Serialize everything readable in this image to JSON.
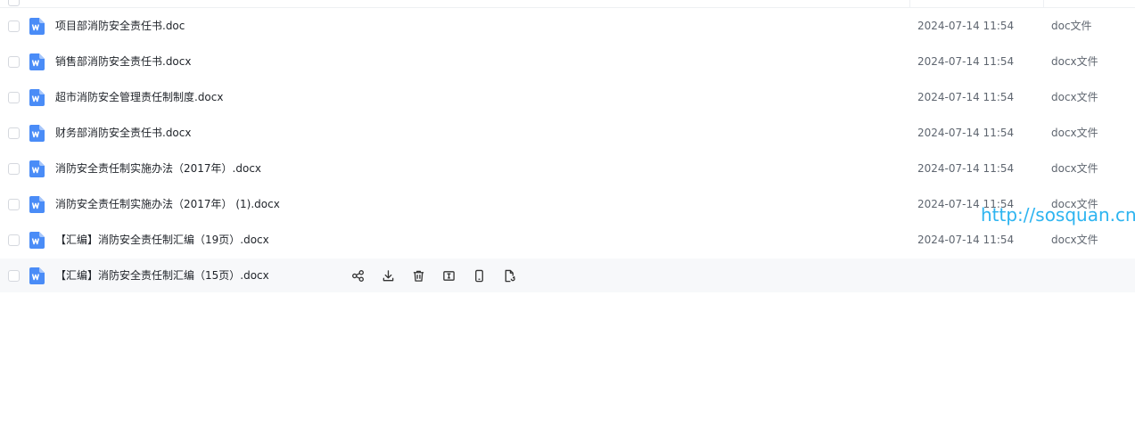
{
  "files": [
    {
      "name": "项目部消防安全责任书.doc",
      "date": "2024-07-14 11:54",
      "type": "doc文件"
    },
    {
      "name": "销售部消防安全责任书.docx",
      "date": "2024-07-14 11:54",
      "type": "docx文件"
    },
    {
      "name": "超市消防安全管理责任制制度.docx",
      "date": "2024-07-14 11:54",
      "type": "docx文件"
    },
    {
      "name": "财务部消防安全责任书.docx",
      "date": "2024-07-14 11:54",
      "type": "docx文件"
    },
    {
      "name": "消防安全责任制实施办法（2017年）.docx",
      "date": "2024-07-14 11:54",
      "type": "docx文件"
    },
    {
      "name": "消防安全责任制实施办法（2017年） (1).docx",
      "date": "2024-07-14 11:54",
      "type": "docx文件"
    },
    {
      "name": "【汇编】消防安全责任制汇编（19页）.docx",
      "date": "2024-07-14 11:54",
      "type": "docx文件"
    },
    {
      "name": "【汇编】消防安全责任制汇编（15页）.docx",
      "date": "",
      "type": ""
    }
  ],
  "hover_actions": [
    "share-icon",
    "download-icon",
    "delete-icon",
    "rename-icon",
    "mobile-icon",
    "copy-icon"
  ],
  "watermark": "http://sosquan.cn",
  "colors": {
    "word_icon": "#4a8cf7",
    "hover_row": "#f7f8fa",
    "watermark": "#2db4f0"
  }
}
